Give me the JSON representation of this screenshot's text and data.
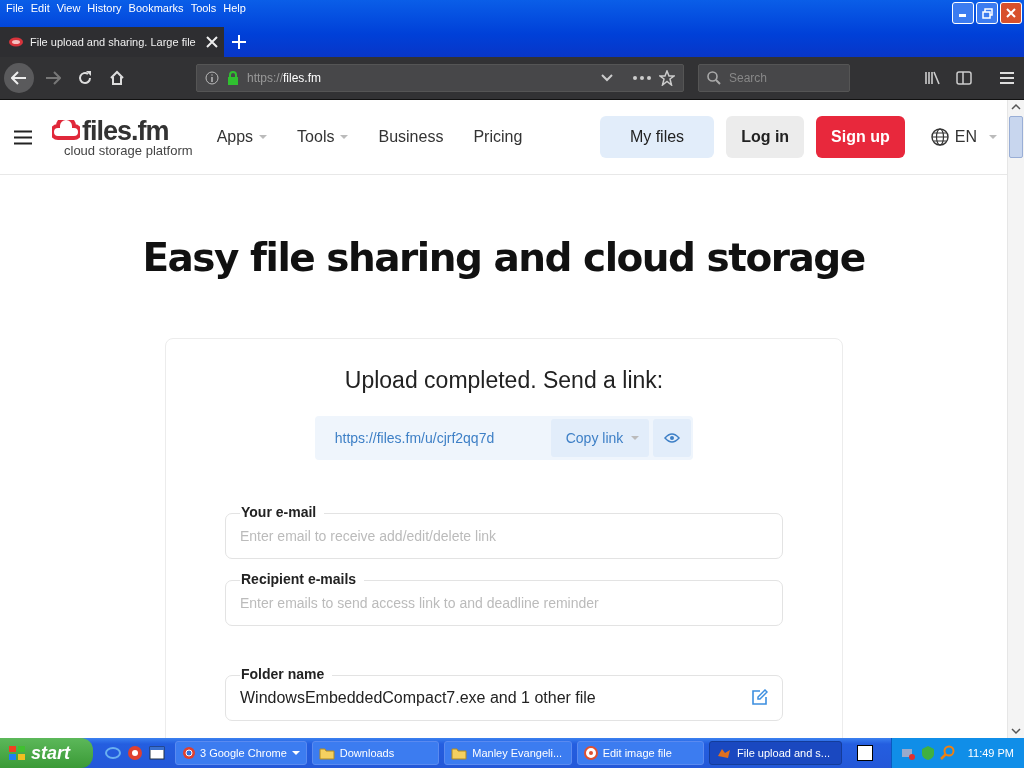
{
  "menu_bar": [
    "File",
    "Edit",
    "View",
    "History",
    "Bookmarks",
    "Tools",
    "Help"
  ],
  "browser_tab": {
    "title": "File upload and sharing. Large file"
  },
  "address_bar": {
    "scheme": "https://",
    "host": "files.fm"
  },
  "search": {
    "placeholder": "Search"
  },
  "site_header": {
    "logo": "files.fm",
    "tagline": "cloud storage platform",
    "nav": [
      {
        "label": "Apps",
        "dropdown": true
      },
      {
        "label": "Tools",
        "dropdown": true
      },
      {
        "label": "Business",
        "dropdown": false
      },
      {
        "label": "Pricing",
        "dropdown": false
      }
    ],
    "buttons": [
      {
        "label": "My files",
        "kind": "soft"
      },
      {
        "label": "Log in",
        "kind": "grey"
      },
      {
        "label": "Sign up",
        "kind": "primary"
      }
    ],
    "language": "EN"
  },
  "heading": "Easy file sharing and cloud storage",
  "upload_card": {
    "title": "Upload completed. Send a link:",
    "link": "https://files.fm/u/cjrf2qq7d",
    "copy_button": "Copy link",
    "fields": [
      {
        "label": "Your e-mail",
        "placeholder": "Enter email to receive add/edit/delete link"
      },
      {
        "label": "Recipient e-mails",
        "placeholder": "Enter emails to send access link to and deadline reminder"
      },
      {
        "label": "Folder name",
        "value": "WindowsEmbeddedCompact7.exe and 1 other file",
        "editable": true
      }
    ]
  },
  "taskbar": {
    "start": "start",
    "tasks": [
      {
        "label": "3 Google Chrome",
        "kind": "group",
        "selected": false
      },
      {
        "label": "Downloads",
        "kind": "folder",
        "selected": false
      },
      {
        "label": "Manley Evangeli...",
        "kind": "folder",
        "selected": false
      },
      {
        "label": "Edit image file",
        "kind": "disc",
        "selected": false
      },
      {
        "label": "File upload and s...",
        "kind": "browser",
        "selected": true
      }
    ],
    "clock": "11:49 PM"
  }
}
